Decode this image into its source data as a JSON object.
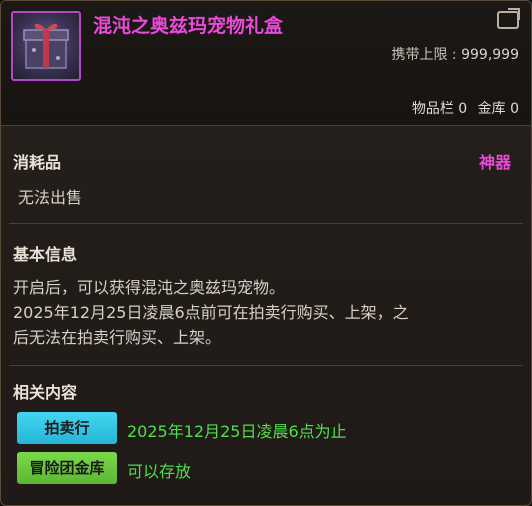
{
  "item": {
    "title": "混沌之奥兹玛宠物礼盒",
    "carry_limit_label": "携带上限 : ",
    "carry_limit_value": "999,999",
    "storage": {
      "inventory": "物品栏 0",
      "bank": "金库 0"
    },
    "icon": "gift-box-icon"
  },
  "category": {
    "type": "消耗品",
    "grade": "神器",
    "trade": "无法出售"
  },
  "basic_info": {
    "title": "基本信息",
    "lines": [
      "开启后，可以获得混沌之奥兹玛宠物。",
      "2025年12月25日凌晨6点前可在拍卖行购买、上架，之",
      "后无法在拍卖行购买、上架。"
    ]
  },
  "related": {
    "title": "相关内容",
    "items": [
      {
        "tag": "拍卖行",
        "note": "2025年12月25日凌晨6点为止"
      },
      {
        "tag": "冒险团金库",
        "note": "可以存放"
      }
    ]
  },
  "colors": {
    "grade_purple": "#e84bd8",
    "note_green": "#4ee04a",
    "auction_cyan": "#41d6f0",
    "bank_green": "#7cd84a"
  }
}
